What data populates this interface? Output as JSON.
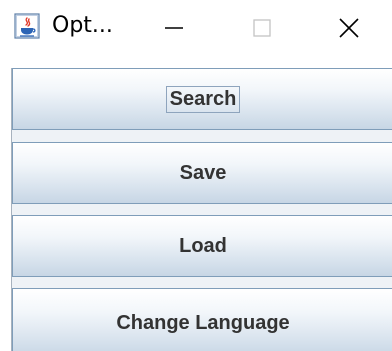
{
  "window": {
    "title": "Opt...",
    "controls": {
      "minimize_icon": "minimize-icon",
      "maximize_icon": "maximize-icon",
      "close_icon": "close-icon"
    }
  },
  "buttons": [
    {
      "label": "Search",
      "focused": true
    },
    {
      "label": "Save"
    },
    {
      "label": "Load"
    },
    {
      "label": "Change Language"
    }
  ],
  "colors": {
    "button_border": "#7f9db9",
    "button_text": "#333333",
    "panel_bg": "#eef2f6"
  }
}
